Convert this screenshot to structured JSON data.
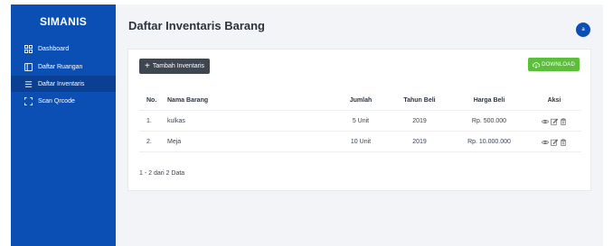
{
  "sidebar": {
    "brand": "SIMANIS",
    "items": [
      {
        "label": "Dashboard",
        "icon": "grid-icon"
      },
      {
        "label": "Daftar Ruangan",
        "icon": "room-icon"
      },
      {
        "label": "Daftar Inventaris",
        "icon": "list-icon"
      },
      {
        "label": "Scan Qrcode",
        "icon": "scan-icon"
      }
    ]
  },
  "header": {
    "title": "Daftar Inventaris Barang",
    "avatar_initial": "a"
  },
  "toolbar": {
    "add_label": "Tambah Inventaris",
    "download_label": "DOWNLOAD"
  },
  "table": {
    "headers": [
      "No.",
      "Nama Barang",
      "Jumlah",
      "Tahun Beli",
      "Harga Beli",
      "Aksi"
    ],
    "rows": [
      {
        "no": "1.",
        "nama": "kulkas",
        "jumlah": "5 Unit",
        "tahun": "2019",
        "harga": "Rp. 500.000"
      },
      {
        "no": "2.",
        "nama": "Meja",
        "jumlah": "10 Unit",
        "tahun": "2019",
        "harga": "Rp. 10.000.000"
      }
    ]
  },
  "pagination": {
    "summary": "1 - 2 dari 2 Data"
  },
  "colors": {
    "sidebar": "#0b4fb5",
    "active": "#0a3f92",
    "download": "#5bbf3c",
    "add_button": "#3e4652"
  }
}
